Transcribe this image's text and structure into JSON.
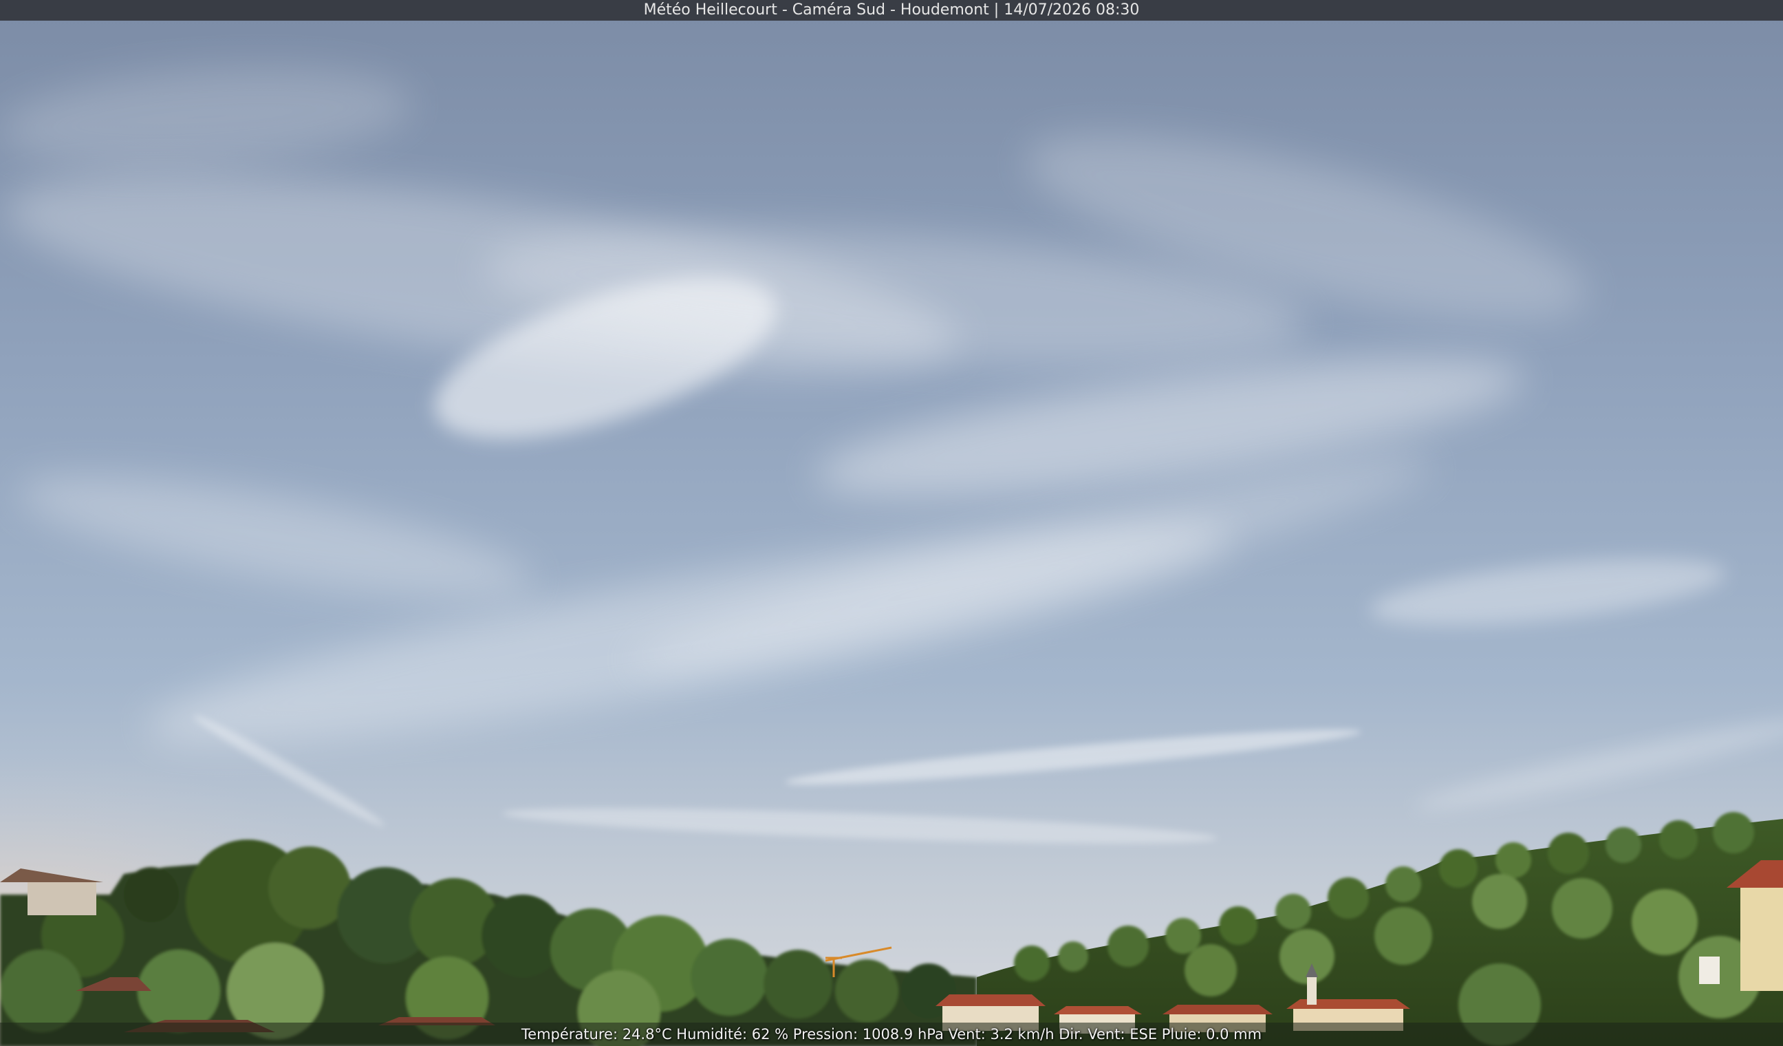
{
  "webcam": {
    "title": "Météo Heillecourt - Caméra Sud - Houdemont | 14/07/2026 08:30",
    "weather_line": "Température: 24.8°C  Humidité: 62 % Pression: 1008.9 hPa Vent: 3.2 km/h Dir. Vent: ESE Pluie: 0.0 mm"
  },
  "scene": {
    "sky_top_color": "#7e8ea8",
    "sky_mid_color": "#97aac2",
    "sky_horizon_color": "#d6d8dc",
    "warm_glow_color": "#e8d6c4",
    "tree_dark_color": "#2a3a1c",
    "tree_mid_color": "#4a6a2c",
    "tree_light_color": "#7a9a4a",
    "roof_color": "#a04a34",
    "wall_color": "#e8d8a8",
    "crane_color": "#d88a2a"
  }
}
